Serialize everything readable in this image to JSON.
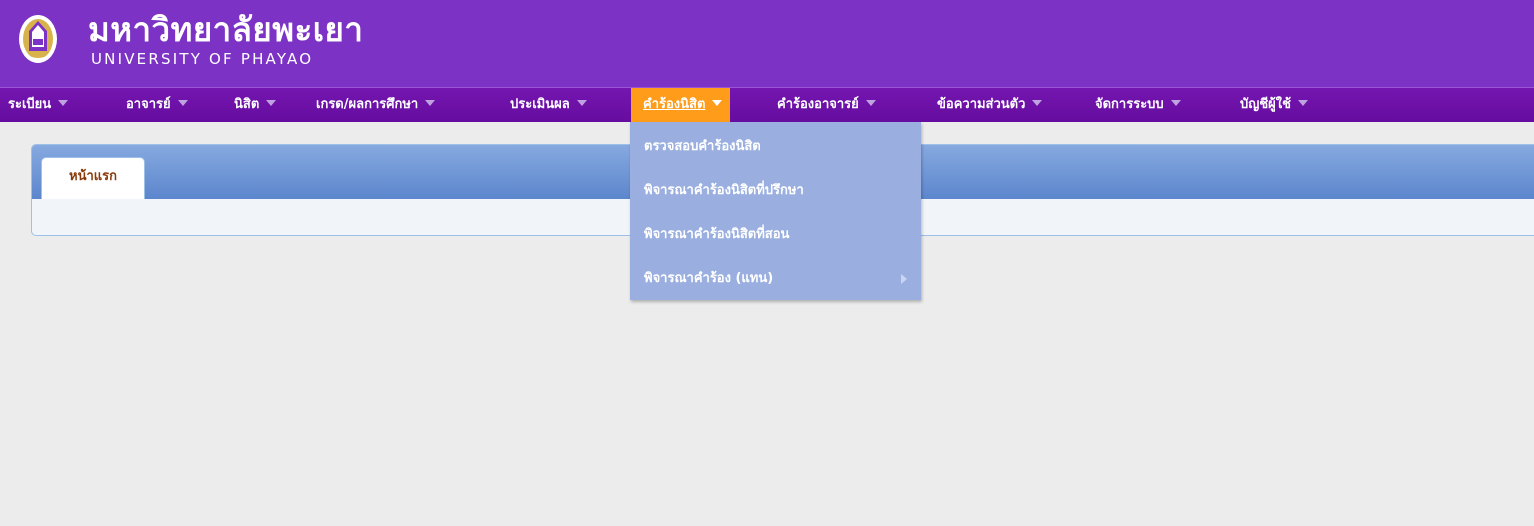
{
  "header": {
    "title_th": "มหาวิทยาลัยพะเยา",
    "title_en": "UNIVERSITY OF PHAYAO",
    "logo_icon": "university-crest-icon",
    "bg_color": "#7c32c4"
  },
  "nav": {
    "items": [
      {
        "label": "ระเบียน"
      },
      {
        "label": "อาจารย์"
      },
      {
        "label": "นิสิต"
      },
      {
        "label": "เกรด/ผลการศึกษา"
      },
      {
        "label": "ประเมินผล"
      },
      {
        "label": "คำร้องนิสิต",
        "active": true
      },
      {
        "label": "คำร้องอาจารย์"
      },
      {
        "label": "ข้อความส่วนตัว"
      },
      {
        "label": "จัดการระบบ"
      },
      {
        "label": "บัญชีผู้ใช้"
      }
    ],
    "active_color": "#ff9c1a"
  },
  "dropdown": {
    "items": [
      {
        "label": "ตรวจสอบคำร้องนิสิต"
      },
      {
        "label": "พิจารณาคำร้องนิสิตที่ปรึกษา"
      },
      {
        "label": "พิจารณาคำร้องนิสิตที่สอน"
      },
      {
        "label": "พิจารณาคำร้อง (แทน)",
        "has_submenu": true
      }
    ]
  },
  "tabs": [
    {
      "label": "หน้าแรก"
    }
  ]
}
